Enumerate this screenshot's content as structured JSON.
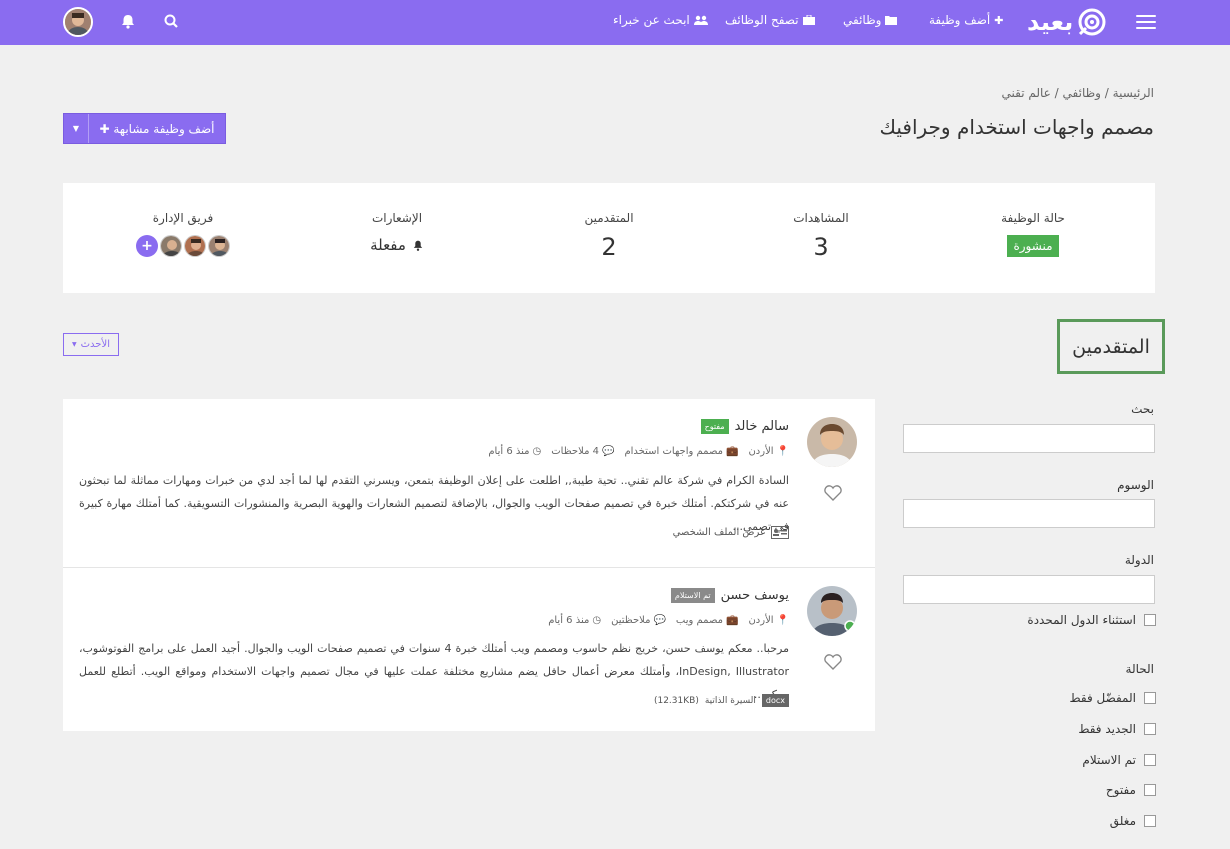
{
  "header": {
    "logo_text": "بعيد",
    "nav": [
      {
        "label": "أضف وظيفة",
        "icon": "plus-icon"
      },
      {
        "label": "وظائفي",
        "icon": "folder-icon"
      },
      {
        "label": "تصفح الوظائف",
        "icon": "briefcase-icon"
      },
      {
        "label": "ابحث عن خبراء",
        "icon": "users-icon"
      }
    ]
  },
  "breadcrumb": {
    "home": "الرئيسية",
    "my_jobs": "وظائفي",
    "company": "عالم تقني",
    "sep": "/"
  },
  "page_title": "مصمم واجهات استخدام وجرافيك",
  "add_similar_label": "أضف وظيفة مشابهة",
  "stats": {
    "status_title": "حالة الوظيفة",
    "status_value": "منشورة",
    "views_title": "المشاهدات",
    "views_value": "3",
    "applicants_title": "المتقدمين",
    "applicants_value": "2",
    "notifications_title": "الإشعارات",
    "notifications_value": "مفعلة",
    "team_title": "فريق الإدارة"
  },
  "applicants_heading": "المتقدمين",
  "sort_label": "الأحدث",
  "filters": {
    "search_label": "بحث",
    "tags_label": "الوسوم",
    "country_label": "الدولة",
    "exclude_countries": "استثناء الدول المحددة",
    "status_label": "الحالة",
    "status_options": [
      "المفضّل فقط",
      "الجديد فقط",
      "تم الاستلام",
      "مفتوح",
      "مغلق"
    ]
  },
  "applicants": [
    {
      "name": "سالم خالد",
      "tag": "مفتوح",
      "country": "الأردن",
      "role": "مصمم واجهات استخدام",
      "notes": "4 ملاحظات",
      "time": "منذ 6 أيام",
      "letter": "السادة الكرام في شركة عالم تقني.. تحية طيبة,, اطلعت على إعلان الوظيفة بتمعن، ويسرني التقدم لها لما أجد لدي من خبرات ومهارات مماثلة لما تبحثون عنه في شركتكم. أمتلك خبرة في تصميم صفحات الويب والجوال، بالإضافة لتصميم الشعارات والهوية البصرية والمنشورات التسويقية. كما أمتلك مهارة كبيرة في تصمي...",
      "profile_link": "عرض الملف الشخصي"
    },
    {
      "name": "يوسف حسن",
      "tag": "تم الاستلام",
      "country": "الأردن",
      "role": "مصمم ويب",
      "notes": "ملاحظتين",
      "time": "منذ 6 أيام",
      "letter": "مرحبا.. معكم يوسف حسن، خريج نظم حاسوب ومصمم ويب أمتلك خبرة 4 سنوات في تصميم صفحات الويب والجوال. أجيد العمل على برامج الفوتوشوب، InDesign, Illustrator، وأمتلك معرض أعمال حافل يضم مشاريع مختلفة عملت عليها في مجال تصميم واجهات الاستخدام ومواقع الويب. أتطلع للعمل معكم...",
      "file_type": "docx",
      "file_name": "السيرة الذاتية",
      "file_size": "(12.31KB)"
    }
  ]
}
